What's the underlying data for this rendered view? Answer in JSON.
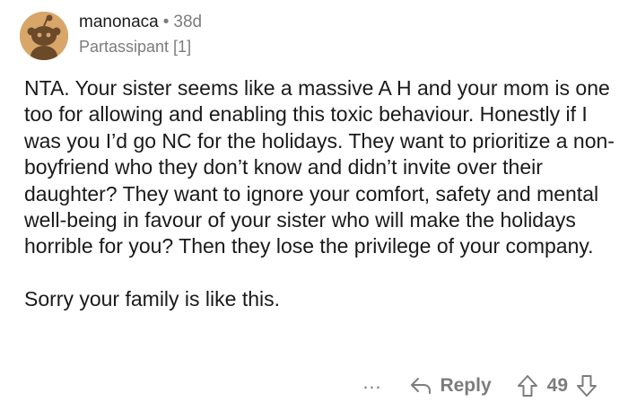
{
  "comment": {
    "author": "manonaca",
    "separator": "•",
    "age": "38d",
    "flair": "Partassipant [1]",
    "paragraphs": [
      "NTA. Your sister seems like a massive A H and your mom is one too for allowing and enabling this toxic behaviour. Honestly if I was you I’d go NC for the holidays. They want to prioritize a non-boyfriend who they don’t know and didn’t invite over their daughter? They want to ignore your comfort, safety and mental well-being in favour of your sister who will make the holidays horrible for you? Then they lose the privilege of your company.",
      "Sorry your family is like this."
    ],
    "score": "49"
  },
  "actions": {
    "more_label": "…",
    "reply_label": "Reply"
  },
  "icons": {
    "more": "more-options-icon",
    "reply": "reply-arrow-icon",
    "upvote": "upvote-arrow-icon",
    "downvote": "downvote-arrow-icon",
    "avatar": "snoo-avatar-icon"
  },
  "colors": {
    "text": "#1a1a1b",
    "muted": "#7c7c7c",
    "avatar_bg": "#d9a66a"
  }
}
